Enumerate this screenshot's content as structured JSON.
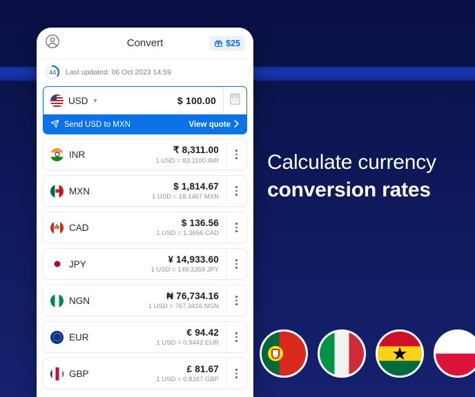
{
  "background": {
    "top_color": "#090f45",
    "bottom_color": "#15216e",
    "band_color": "#1436ad"
  },
  "marketing": {
    "headline_line1": "Calculate currency",
    "headline_line2": "conversion rates",
    "flags": [
      {
        "name": "portugal-flag",
        "label": "Portugal"
      },
      {
        "name": "italy-flag",
        "label": "Italy"
      },
      {
        "name": "ghana-flag",
        "label": "Ghana"
      },
      {
        "name": "poland-flag",
        "label": "Poland"
      }
    ]
  },
  "phone": {
    "header": {
      "title": "Convert",
      "avatar_icon": "user-circle-icon",
      "gift_icon": "gift-icon",
      "gift_amount": "$25"
    },
    "status": {
      "timer_value": "44",
      "updated_text": "Last updated: 06 Oct 2023 14:59"
    },
    "converter": {
      "flag": "us-flag",
      "currency_code": "USD",
      "caret_icon": "chevron-down-icon",
      "amount": "$ 100.00",
      "calculator_icon": "calculator-icon"
    },
    "send_banner": {
      "send_icon": "paper-plane-icon",
      "label": "Send USD to MXN",
      "cta": "View quote",
      "cta_icon": "chevron-right-icon"
    },
    "currencies": [
      {
        "flag": "f-in",
        "code": "INR",
        "amount": "₹ 8,311.00",
        "rate": "1 USD = 83.1100 INR"
      },
      {
        "flag": "f-mx",
        "code": "MXN",
        "amount": "$ 1,814.67",
        "rate": "1 USD = 18.1467 MXN"
      },
      {
        "flag": "f-ca",
        "code": "CAD",
        "amount": "$ 136.56",
        "rate": "1 USD = 1.3656 CAD"
      },
      {
        "flag": "f-jp",
        "code": "JPY",
        "amount": "¥ 14,933.60",
        "rate": "1 USD = 149.3359 JPY"
      },
      {
        "flag": "f-ng",
        "code": "NGN",
        "amount": "₦ 76,734.16",
        "rate": "1 USD = 767.3416 NGN"
      },
      {
        "flag": "f-eu",
        "code": "EUR",
        "amount": "€ 94.42",
        "rate": "1 USD = 0.9442 EUR"
      },
      {
        "flag": "f-gb",
        "code": "GBP",
        "amount": "£ 81.67",
        "rate": "1 USD = 0.8167 GBP"
      }
    ]
  }
}
